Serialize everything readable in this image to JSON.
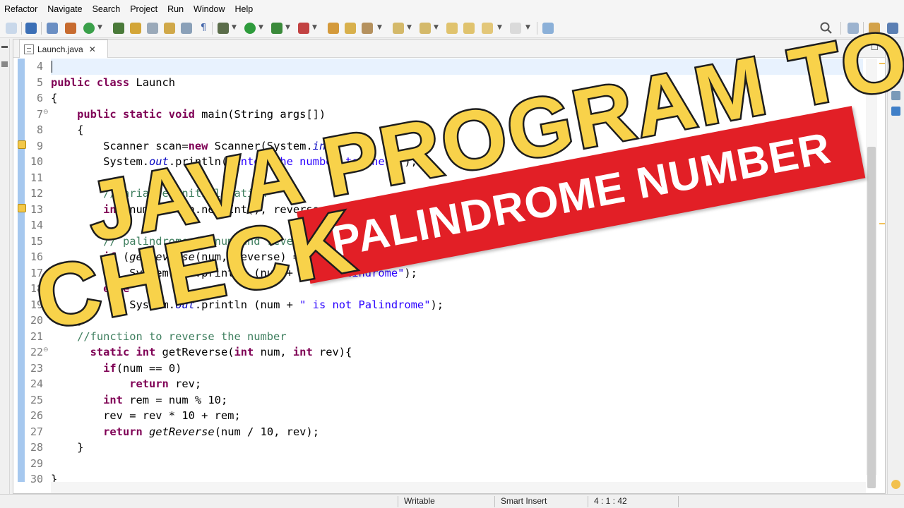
{
  "menu": {
    "items": [
      "Refactor",
      "Navigate",
      "Search",
      "Project",
      "Run",
      "Window",
      "Help"
    ]
  },
  "editor": {
    "tab_label": "Launch.java",
    "tab_icon": "java-file-icon",
    "line_numbers": [
      "4",
      "5",
      "6",
      "7",
      "8",
      "9",
      "10",
      "11",
      "12",
      "13",
      "14",
      "15",
      "16",
      "17",
      "18",
      "19",
      "20",
      "21",
      "22",
      "23",
      "24",
      "25",
      "26",
      "27",
      "28",
      "29",
      "30"
    ]
  },
  "overlay": {
    "title_line1": "JAVA PROGRAM TO",
    "title_line2": "CHECK",
    "banner": "PALINDROME NUMBER",
    "colors": {
      "title": "#f8d24a",
      "banner": "#e21f26",
      "banner_text": "#ffffff"
    }
  },
  "status": {
    "mode": "Writable",
    "insert": "Smart Insert",
    "position": "4 : 1 : 42"
  }
}
